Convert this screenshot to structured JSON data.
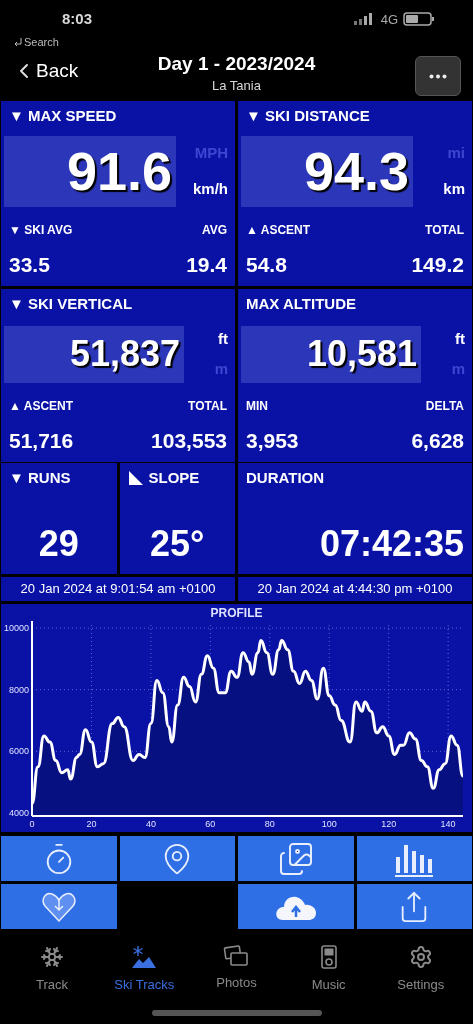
{
  "status_bar": {
    "time": "8:03",
    "back_hint": "Search",
    "network": "4G"
  },
  "nav": {
    "back_label": "Back",
    "title": "Day 1 - 2023/2024",
    "subtitle": "La Tania"
  },
  "tiles": [
    {
      "kind": "large",
      "title": "▼ MAX SPEED",
      "value": "91.6",
      "units": [
        {
          "label": "MPH",
          "selected": false
        },
        {
          "label": "km/h",
          "selected": true
        }
      ],
      "stats": [
        {
          "label": "▼ SKI AVG",
          "value": "33.5"
        },
        {
          "label": "AVG",
          "value": "19.4"
        }
      ]
    },
    {
      "kind": "large",
      "title": "▼ SKI DISTANCE",
      "value": "94.3",
      "units": [
        {
          "label": "mi",
          "selected": false
        },
        {
          "label": "km",
          "selected": true
        }
      ],
      "stats": [
        {
          "label": "▲ ASCENT",
          "value": "54.8"
        },
        {
          "label": "TOTAL",
          "value": "149.2"
        }
      ]
    },
    {
      "kind": "medium",
      "title": "▼ SKI VERTICAL",
      "value": "51,837",
      "units": [
        {
          "label": "ft",
          "selected": true
        },
        {
          "label": "m",
          "selected": false
        }
      ],
      "stats": [
        {
          "label": "▲ ASCENT",
          "value": "51,716"
        },
        {
          "label": "TOTAL",
          "value": "103,553"
        }
      ]
    },
    {
      "kind": "medium",
      "title": "MAX ALTITUDE",
      "value": "10,581",
      "units": [
        {
          "label": "ft",
          "selected": true
        },
        {
          "label": "m",
          "selected": false
        }
      ],
      "stats": [
        {
          "label": "MIN",
          "value": "3,953"
        },
        {
          "label": "DELTA",
          "value": "6,628"
        }
      ]
    }
  ],
  "small_tiles": [
    {
      "kind": "plain",
      "title": "▼ RUNS",
      "value": "29"
    },
    {
      "kind": "slope",
      "title": "SLOPE",
      "value": "25°"
    },
    {
      "kind": "plain",
      "title": "DURATION",
      "value": "07:42:35"
    }
  ],
  "times": [
    "20 Jan 2024 at 9:01:54 am +0100",
    "20 Jan 2024 at 4:44:30 pm +0100"
  ],
  "profile": {
    "chart_data": {
      "type": "area",
      "title": "PROFILE",
      "x": [
        0,
        2,
        4,
        6,
        8,
        10,
        12,
        13,
        15,
        16,
        18,
        20,
        22,
        24,
        27,
        29,
        31,
        34,
        36,
        38,
        40,
        42,
        44,
        46,
        47,
        49,
        51,
        53,
        55,
        57,
        59,
        61,
        63,
        65,
        67,
        69,
        71,
        73,
        74,
        76,
        77,
        79,
        81,
        83,
        84,
        86,
        88,
        90,
        92,
        94,
        96,
        98,
        100,
        102,
        104,
        107,
        109,
        111,
        112,
        114,
        116,
        118,
        120,
        122,
        124,
        125,
        127,
        129,
        131,
        133,
        135,
        137,
        139,
        141,
        143,
        145
      ],
      "grid": true,
      "series": [
        {
          "color": "#ffffff",
          "values": [
            4300,
            5500,
            6500,
            6300,
            5700,
            5300,
            5400,
            5100,
            5800,
            5900,
            6700,
            6300,
            5500,
            5600,
            6900,
            7100,
            6800,
            5700,
            5900,
            5800,
            6900,
            8300,
            7900,
            6800,
            6300,
            7500,
            8400,
            8100,
            7600,
            8500,
            9100,
            8700,
            7900,
            7900,
            8600,
            8400,
            9200,
            8900,
            8500,
            9200,
            9600,
            9200,
            8500,
            9300,
            9600,
            9300,
            8600,
            8200,
            8600,
            8300,
            7700,
            8700,
            7800,
            7500,
            7000,
            6300,
            7600,
            7300,
            7600,
            7300,
            6600,
            6800,
            6500,
            5900,
            6200,
            6200,
            6600,
            6400,
            5700,
            5500,
            4800,
            5400,
            5600,
            6500,
            6200,
            5200
          ]
        }
      ],
      "xlim": [
        0,
        145
      ],
      "ylim": [
        3900,
        10100
      ],
      "xticks": [
        0,
        20,
        40,
        60,
        80,
        100,
        120,
        140
      ],
      "yticks": [
        4000,
        6000,
        8000,
        10000
      ]
    }
  },
  "actions": [
    {
      "kind": "timer"
    },
    {
      "kind": "map"
    },
    {
      "kind": "photos"
    },
    {
      "kind": "bars"
    },
    {
      "kind": "favourite"
    },
    {
      "kind": "empty"
    },
    {
      "kind": "cloud"
    },
    {
      "kind": "share"
    }
  ],
  "tabs": [
    {
      "label": "Track",
      "kind": "snowflake",
      "selected": false
    },
    {
      "label": "Ski Tracks",
      "kind": "mountain",
      "selected": true
    },
    {
      "label": "Photos",
      "kind": "photos",
      "selected": false
    },
    {
      "label": "Music",
      "kind": "player",
      "selected": false
    },
    {
      "label": "Settings",
      "kind": "gear",
      "selected": false
    }
  ]
}
